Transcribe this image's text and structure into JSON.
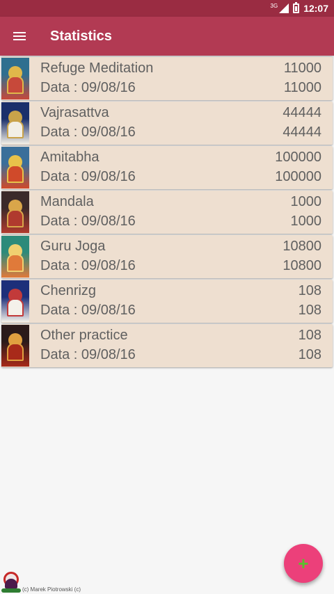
{
  "status_bar": {
    "network": "3G",
    "time": "12:07"
  },
  "app_bar": {
    "title": "Statistics"
  },
  "items": [
    {
      "name": "Refuge Meditation",
      "count": "11000",
      "date_label": "Data : 09/08/16",
      "date_count": "11000",
      "colors": [
        "#2f6f8f",
        "#c7493a",
        "#e0b84a"
      ]
    },
    {
      "name": "Vajrasattva",
      "count": "44444",
      "date_label": "Data : 09/08/16",
      "date_count": "44444",
      "colors": [
        "#1b2f6b",
        "#f2efe6",
        "#c9a34a"
      ]
    },
    {
      "name": "Amitabha",
      "count": "100000",
      "date_label": "Data : 09/08/16",
      "date_count": "100000",
      "colors": [
        "#3a6f9a",
        "#d04a2a",
        "#e8c24a"
      ]
    },
    {
      "name": "Mandala",
      "count": "1000",
      "date_label": "Data : 09/08/16",
      "date_count": "1000",
      "colors": [
        "#3b2a2a",
        "#b03a2e",
        "#d9a64a"
      ]
    },
    {
      "name": "Guru Joga",
      "count": "10800",
      "date_label": "Data : 09/08/16",
      "date_count": "10800",
      "colors": [
        "#2d8a7a",
        "#e07a3a",
        "#f0d070"
      ]
    },
    {
      "name": "Chenrizg",
      "count": "108",
      "date_label": "Data : 09/08/16",
      "date_count": "108",
      "colors": [
        "#1d2f7a",
        "#f4f1ea",
        "#c23a3a"
      ]
    },
    {
      "name": "Other practice",
      "count": "108",
      "date_label": "Data : 09/08/16",
      "date_count": "108",
      "colors": [
        "#2a1a1a",
        "#a82a1a",
        "#e0a040"
      ]
    }
  ],
  "fab": {
    "icon": "plus-icon",
    "symbol": "+"
  },
  "footer": {
    "copyright": "(c) Marek Piotrowski (c)"
  }
}
